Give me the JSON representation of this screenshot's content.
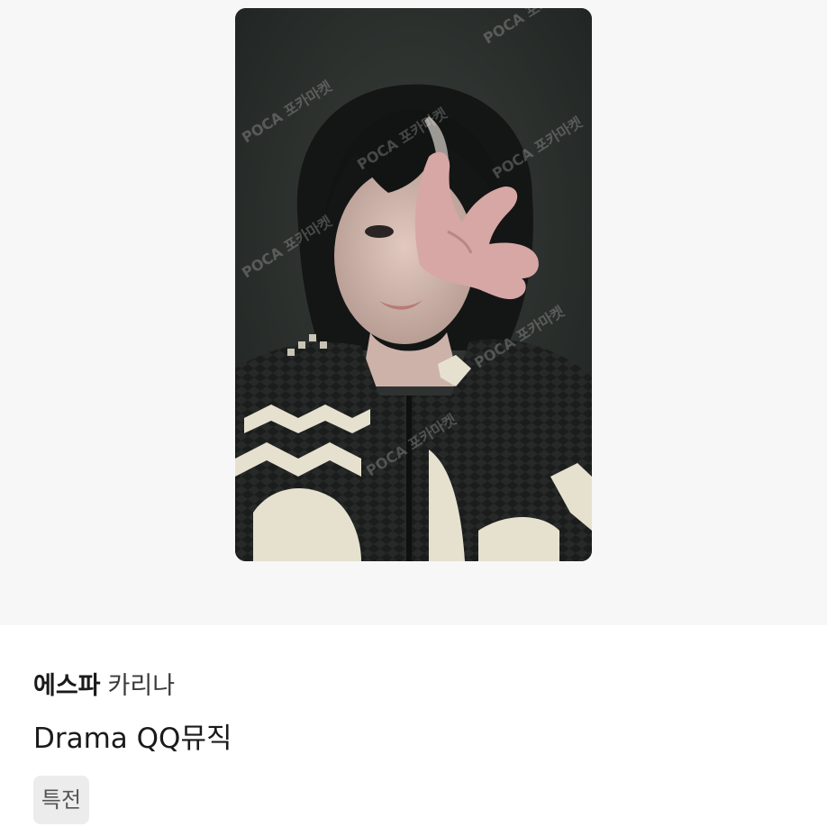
{
  "listing": {
    "group_name": "에스파",
    "member_name": "카리나",
    "album_title": "Drama QQ뮤직",
    "tag_label": "특전"
  },
  "photo": {
    "watermark_text": "POCA 포카마켓",
    "subject": "selfie photocard with peace sign, black and white knit sweater"
  },
  "colors": {
    "hero_background": "#f7f7f7",
    "card_background": "#2c302e",
    "badge_background": "#ececec"
  }
}
